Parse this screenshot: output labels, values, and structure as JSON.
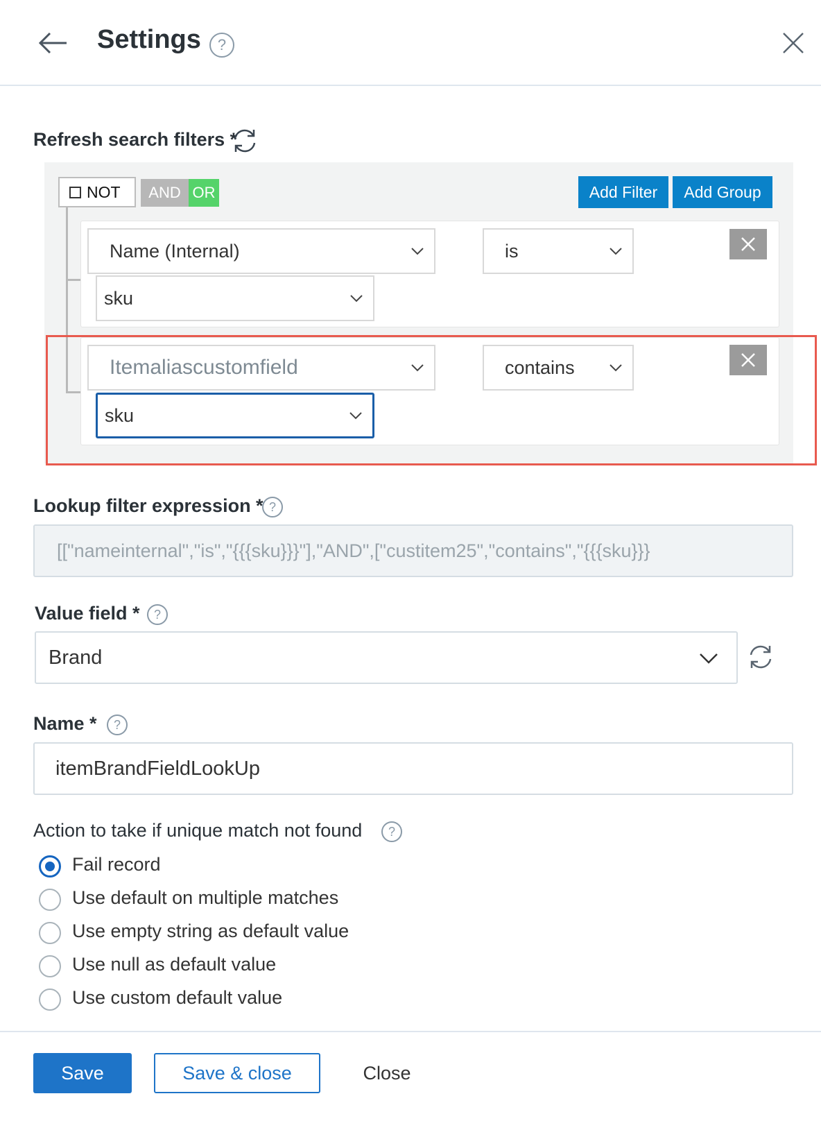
{
  "header": {
    "title": "Settings",
    "help_glyph": "?"
  },
  "filters": {
    "label": "Refresh search filters *",
    "not_label": "NOT",
    "and_label": "AND",
    "or_label": "OR",
    "add_filter": "Add Filter",
    "add_group": "Add Group",
    "rules": [
      {
        "field": "Name (Internal)",
        "operator": "is",
        "value": "sku"
      },
      {
        "field": "Itemaliascustomfield",
        "operator": "contains",
        "value": "sku"
      }
    ]
  },
  "lookup": {
    "label": "Lookup filter expression *",
    "value": "[[\"nameinternal\",\"is\",\"{{{sku}}}\"],\"AND\",[\"custitem25\",\"contains\",\"{{{sku}}}"
  },
  "value_field": {
    "label": "Value field *",
    "selected": "Brand"
  },
  "name": {
    "label": "Name *",
    "value": "itemBrandFieldLookUp"
  },
  "action": {
    "label": "Action to take if unique match not found",
    "options": [
      "Fail record",
      "Use default on multiple matches",
      "Use empty string as default value",
      "Use null as default value",
      "Use custom default value"
    ],
    "selected_index": 0
  },
  "footer": {
    "save": "Save",
    "save_close": "Save & close",
    "close": "Close"
  },
  "colors": {
    "primary": "#1e74c8",
    "filter_button": "#0a82c9",
    "or_active": "#55d36a",
    "highlight": "#e85a4f"
  }
}
